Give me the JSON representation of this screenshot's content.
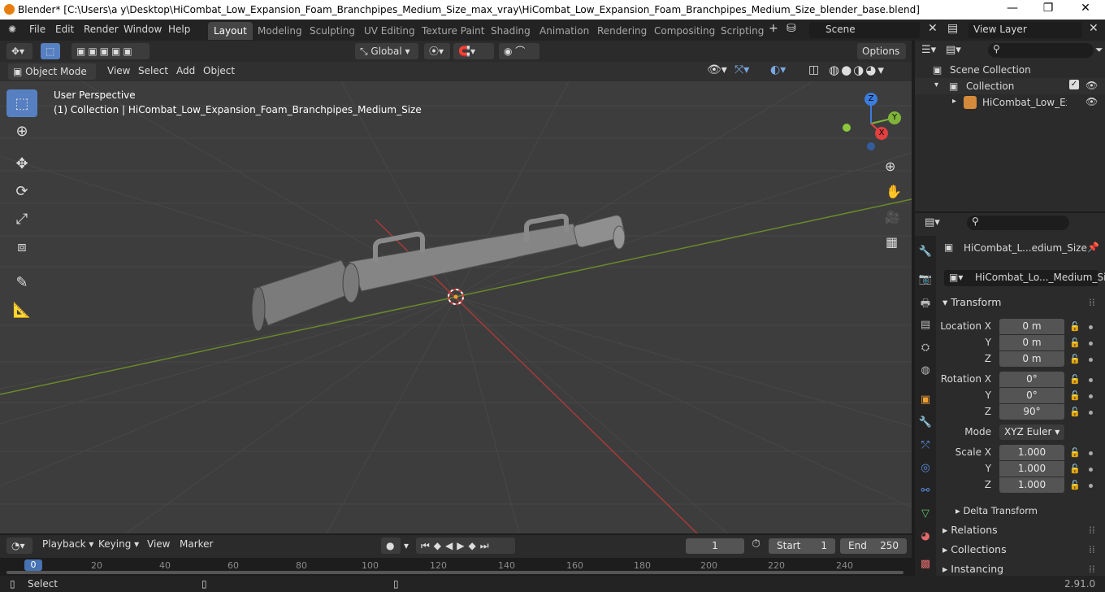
{
  "window": {
    "title": "Blender* [C:\\Users\\a y\\Desktop\\HiCombat_Low_Expansion_Foam_Branchpipes_Medium_Size_max_vray\\HiCombat_Low_Expansion_Foam_Branchpipes_Medium_Size_blender_base.blend]",
    "minimize": "—",
    "maximize": "❐",
    "close": "✕"
  },
  "menu": [
    "File",
    "Edit",
    "Render",
    "Window",
    "Help"
  ],
  "workspaces": [
    "Layout",
    "Modeling",
    "Sculpting",
    "UV Editing",
    "Texture Paint",
    "Shading",
    "Animation",
    "Rendering",
    "Compositing",
    "Scripting"
  ],
  "workspace_add": "+",
  "scene": {
    "label": "Scene",
    "view_layer": "View Layer"
  },
  "header": {
    "transform_orientation": "Global",
    "options": "Options",
    "mode": "Object Mode",
    "menus": [
      "View",
      "Select",
      "Add",
      "Object"
    ]
  },
  "viewport": {
    "perspective": "User Perspective",
    "collection_info": "(1) Collection | HiCombat_Low_Expansion_Foam_Branchpipes_Medium_Size",
    "axes": {
      "z": "Z",
      "y": "Y",
      "x": "X"
    }
  },
  "outliner": {
    "scene_collection": "Scene Collection",
    "collection": "Collection",
    "object": "HiCombat_Low_Expa"
  },
  "properties": {
    "object_name": "HiCombat_L...edium_Size",
    "data_name": "HiCombat_Lo..._Medium_Size",
    "transform_title": "Transform",
    "location_label": "Location X",
    "rotation_label": "Rotation X",
    "scale_label": "Scale X",
    "y_label": "Y",
    "z_label": "Z",
    "location": [
      "0 m",
      "0 m",
      "0 m"
    ],
    "rotation": [
      "0°",
      "0°",
      "90°"
    ],
    "mode_label": "Mode",
    "mode_value": "XYZ Euler",
    "scale": [
      "1.000",
      "1.000",
      "1.000"
    ],
    "delta_transform": "Delta Transform",
    "relations": "Relations",
    "collections": "Collections",
    "instancing": "Instancing"
  },
  "timeline": {
    "menus": [
      "Playback",
      "Keying",
      "View",
      "Marker"
    ],
    "current_frame": "1",
    "start_label": "Start",
    "start_value": "1",
    "end_label": "End",
    "end_value": "250",
    "ruler": [
      "0",
      "20",
      "40",
      "60",
      "80",
      "100",
      "120",
      "140",
      "160",
      "180",
      "200",
      "220",
      "240"
    ]
  },
  "status": {
    "select": "Select",
    "version": "2.91.0"
  }
}
